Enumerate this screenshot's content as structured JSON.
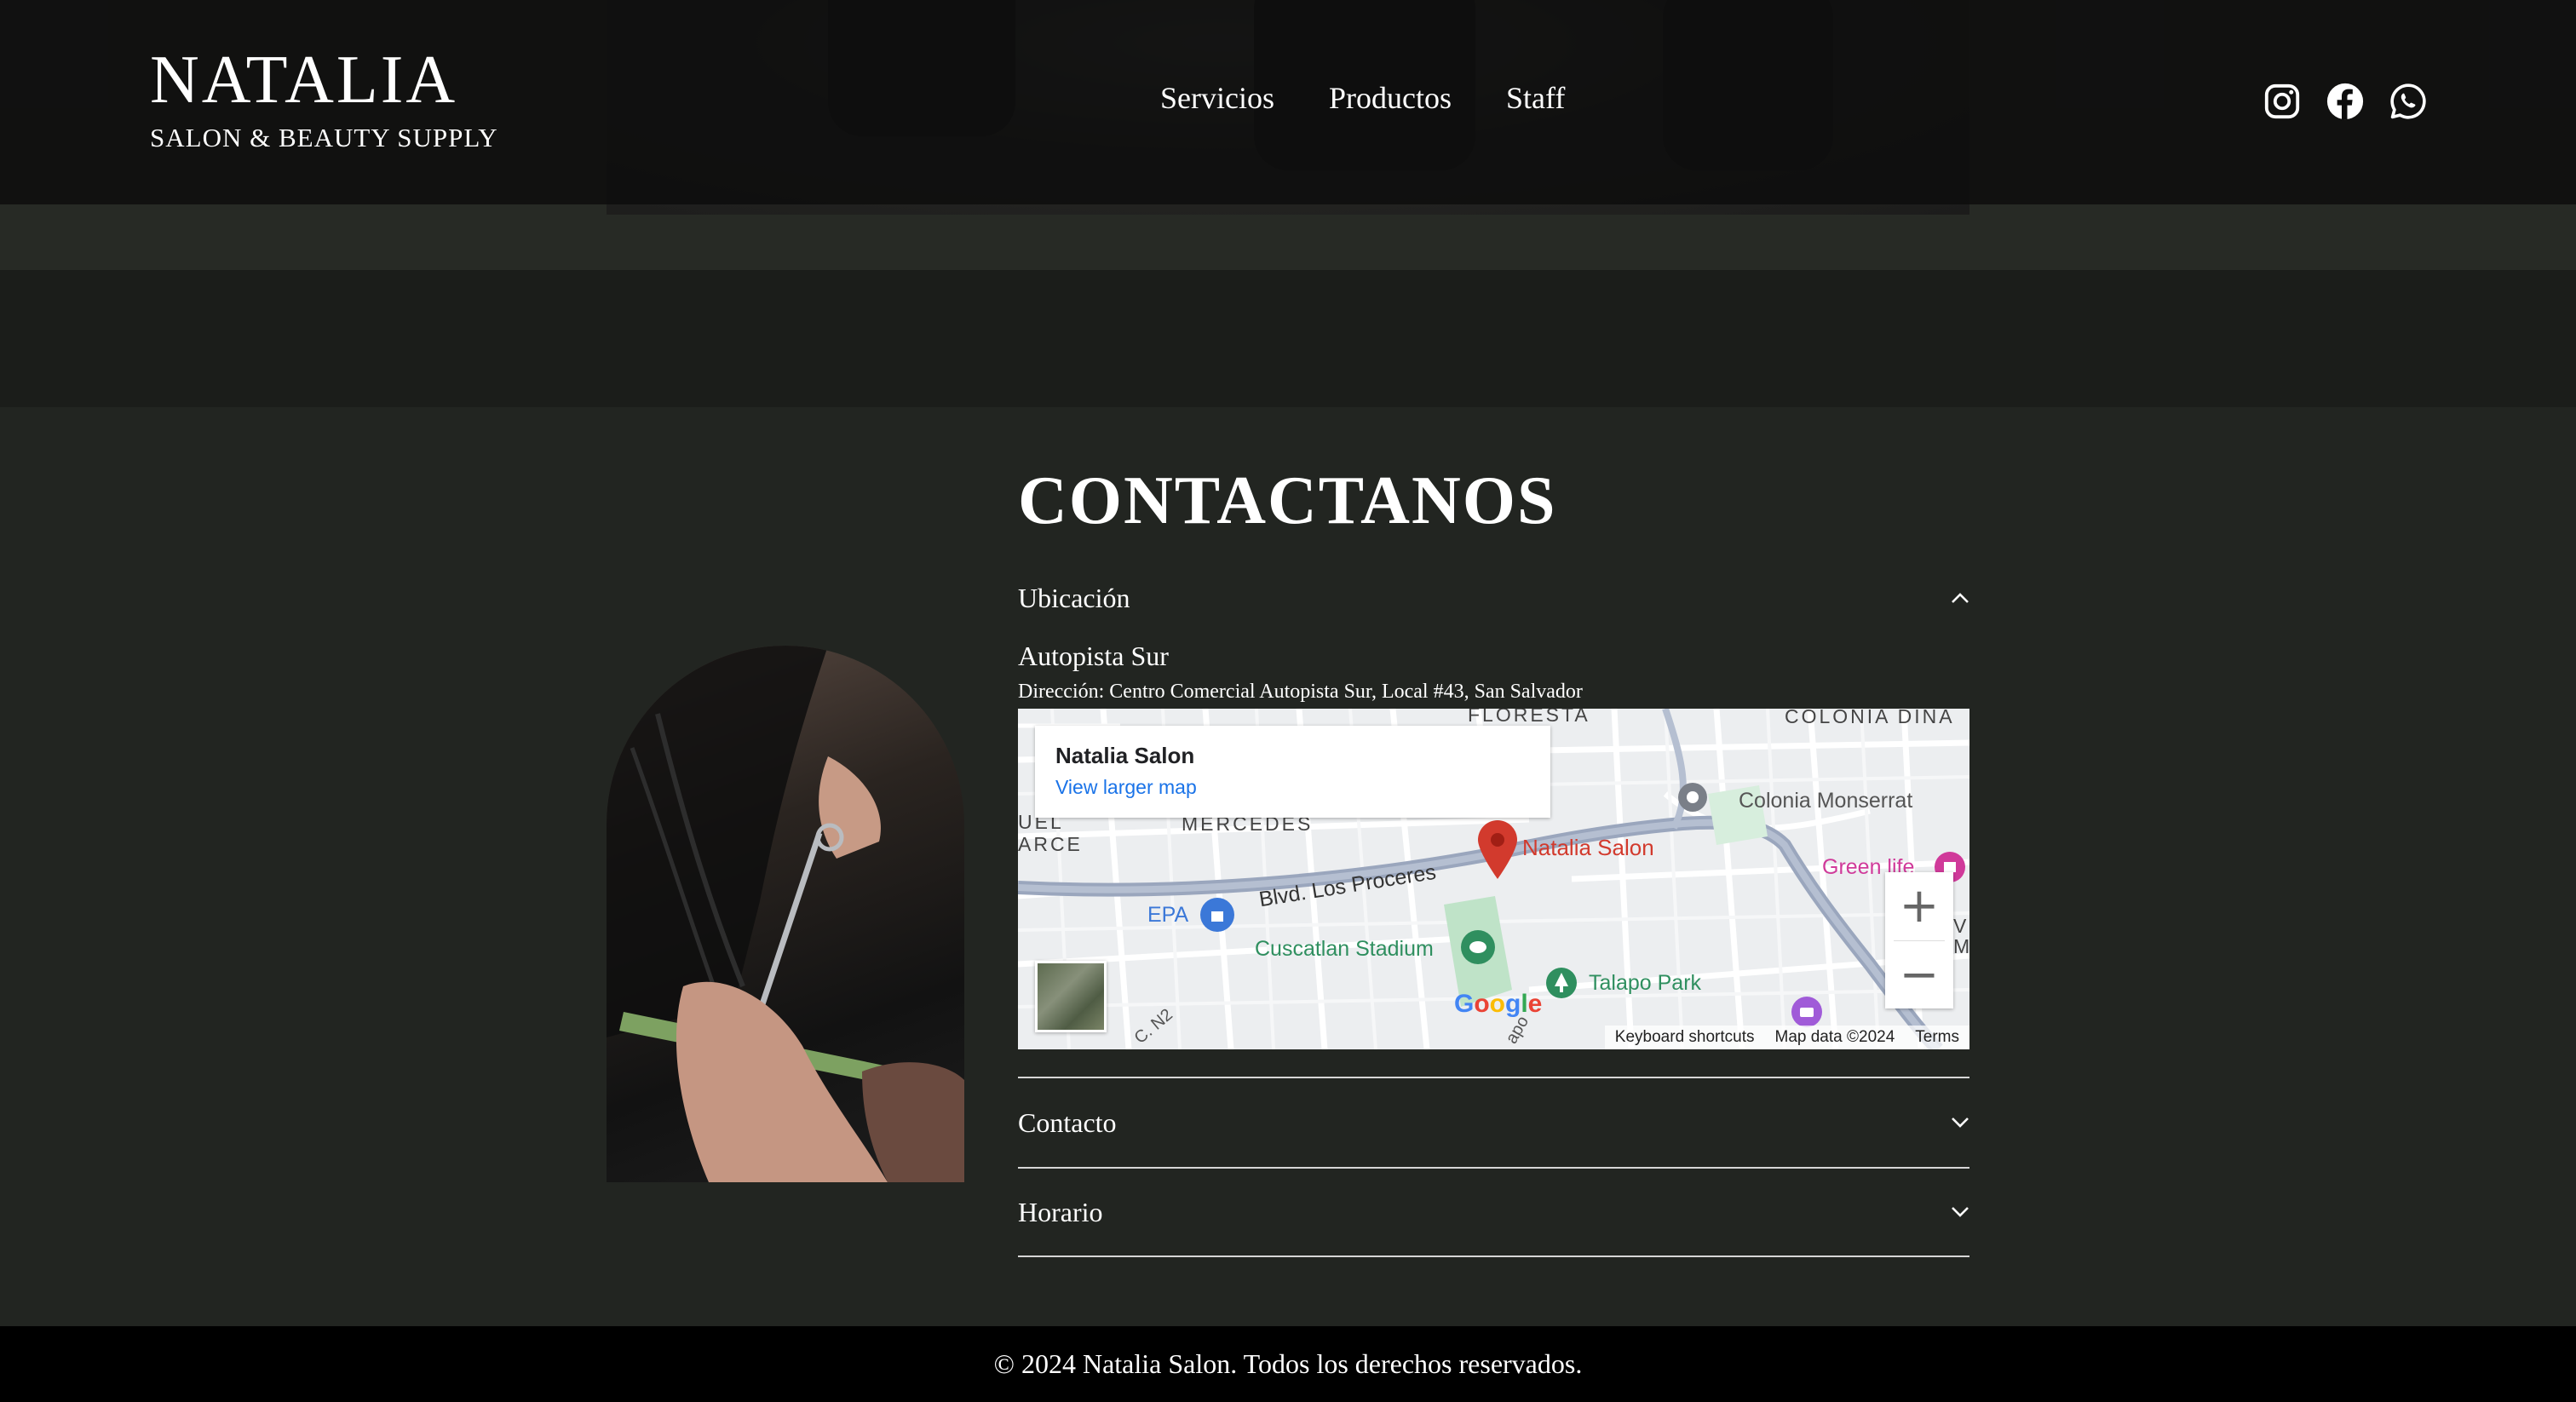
{
  "header": {
    "brand_title": "NATALIA",
    "brand_subtitle": "SALON & BEAUTY SUPPLY",
    "nav": [
      {
        "label": "Servicios"
      },
      {
        "label": "Productos"
      },
      {
        "label": "Staff"
      }
    ],
    "social_icons": [
      "instagram-icon",
      "facebook-icon",
      "whatsapp-icon"
    ]
  },
  "contact": {
    "title": "CONTACTANOS",
    "sections": [
      {
        "label": "Ubicación",
        "expanded": true,
        "location_name": "Autopista Sur",
        "address": "Dirección: Centro Comercial Autopista Sur, Local #43, San Salvador"
      },
      {
        "label": "Contacto",
        "expanded": false
      },
      {
        "label": "Horario",
        "expanded": false
      }
    ]
  },
  "map": {
    "place_name": "Natalia Salon",
    "larger_map_link": "View larger map",
    "labels": {
      "floresta": "FLORESTA",
      "colonia_dina": "COLONIA DINA",
      "uel": "UEL",
      "arce": "ARCE",
      "mercedes": "MERCEDES",
      "colonia_monserrat": "Colonia Monserrat",
      "pin_label": "Natalia Salon",
      "green_life": "Green life",
      "blvd": "Blvd. Los Proceres",
      "epa": "EPA",
      "cuscatlan": "Cuscatlan Stadium",
      "talapo": "Talapo Park",
      "n2": "C. N2",
      "vi": "VI",
      "mc": "MC",
      "apo": "apo"
    },
    "zoom_in": "+",
    "zoom_out": "−",
    "google_logo": [
      "G",
      "o",
      "o",
      "g",
      "l",
      "e"
    ],
    "footer": {
      "shortcuts": "Keyboard shortcuts",
      "map_data": "Map data ©2024",
      "terms": "Terms"
    }
  },
  "footer": {
    "copyright": "© 2024 Natalia Salon. Todos los derechos reservados."
  },
  "colors": {
    "page_bg": "#222521",
    "header_bg": "#0c0c0c",
    "footer_bg": "#000000",
    "text": "#ffffff",
    "map_pin": "#d23a2d",
    "map_link": "#1a73e8"
  }
}
